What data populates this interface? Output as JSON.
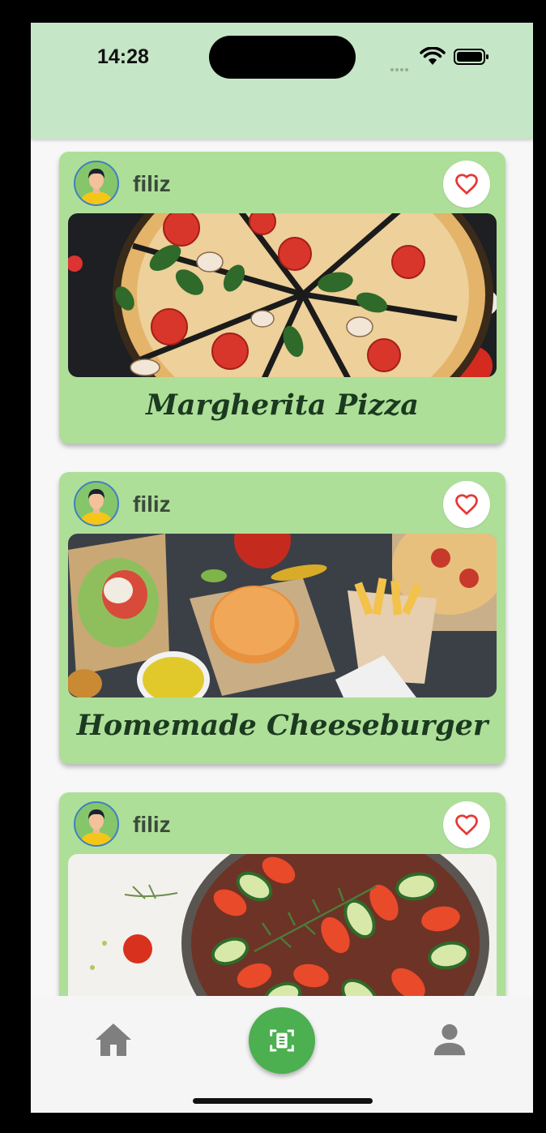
{
  "status_bar": {
    "time": "14:28"
  },
  "feed": {
    "posts": [
      {
        "username": "filiz",
        "title": "Margherita Pizza",
        "image": "pizza-photo",
        "liked": false
      },
      {
        "username": "filiz",
        "title": "Homemade Cheeseburger",
        "image": "burger-fries-salad-photo",
        "liked": false
      },
      {
        "username": "filiz",
        "title": "",
        "image": "ratatouille-photo",
        "liked": false
      }
    ]
  },
  "bottom_nav": {
    "items": [
      {
        "icon": "home-icon"
      },
      {
        "icon": "scan-document-icon"
      },
      {
        "icon": "person-icon"
      }
    ]
  },
  "colors": {
    "header": "#c5e6c7",
    "card": "#aedf99",
    "title_text": "#1b3a20",
    "heart": "#e53935",
    "fab": "#4caf50"
  }
}
